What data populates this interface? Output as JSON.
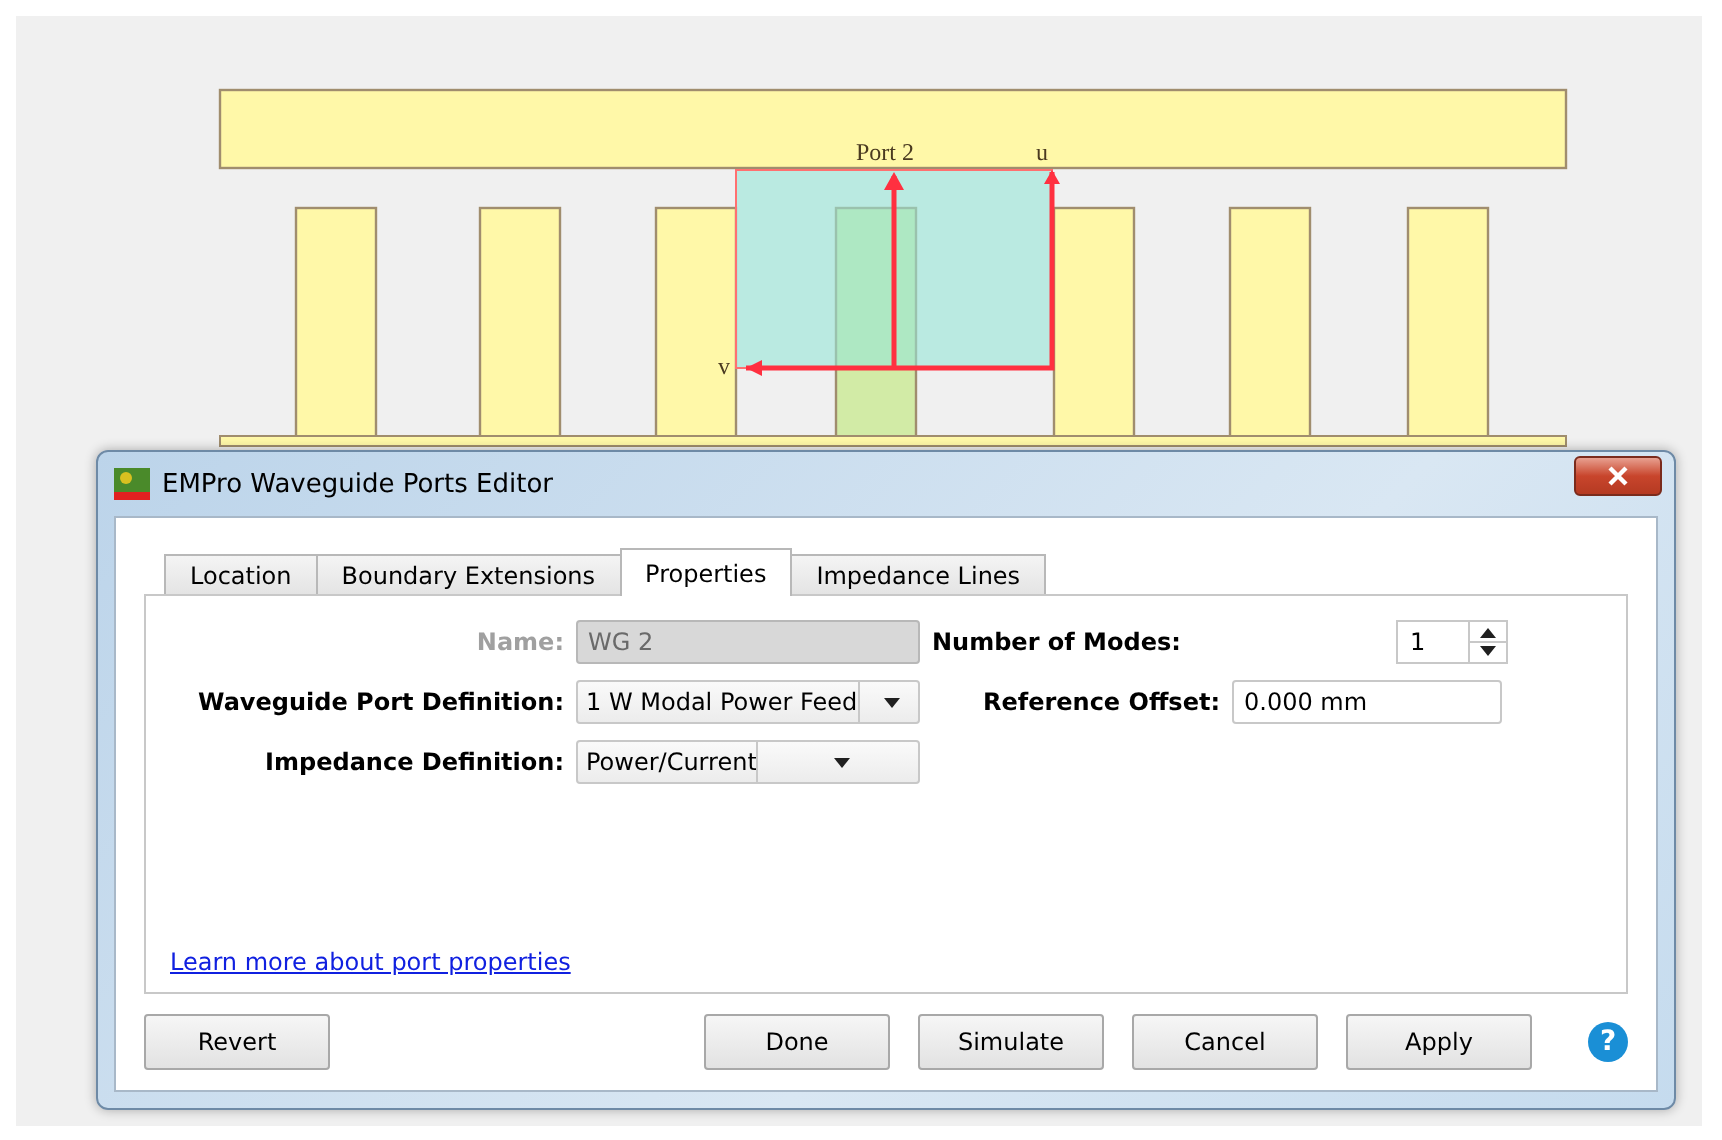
{
  "viewport": {
    "port_label": "Port 2",
    "u_label": "u",
    "v_label": "v"
  },
  "dialog": {
    "title": "EMPro Waveguide Ports Editor",
    "tabs": [
      {
        "label": "Location",
        "selected": false
      },
      {
        "label": "Boundary Extensions",
        "selected": false
      },
      {
        "label": "Properties",
        "selected": true
      },
      {
        "label": "Impedance Lines",
        "selected": false
      }
    ],
    "name": {
      "label": "Name:",
      "value": "WG 2",
      "disabled": true
    },
    "number_of_modes": {
      "label": "Number of Modes:",
      "value": "1"
    },
    "waveguide_port_definition": {
      "label": "Waveguide Port Definition:",
      "value": "1 W Modal Power Feed"
    },
    "reference_offset": {
      "label": "Reference Offset:",
      "value": "0.000 mm"
    },
    "impedance_definition": {
      "label": "Impedance Definition:",
      "value": "Power/Current"
    },
    "link": "Learn more about port properties",
    "left_buttons": [
      "Revert"
    ],
    "right_buttons": [
      "Done",
      "Simulate",
      "Cancel",
      "Apply"
    ],
    "help": "?"
  }
}
